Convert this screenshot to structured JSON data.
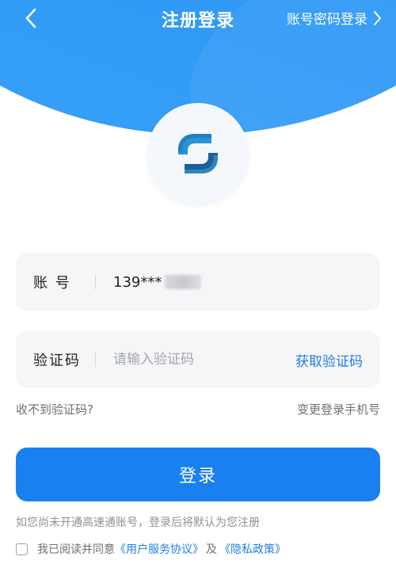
{
  "header": {
    "title": "注册登录",
    "password_login": "账号密码登录"
  },
  "form": {
    "account": {
      "label": "账 号",
      "value": "139***"
    },
    "code": {
      "label": "验证码",
      "placeholder": "请输入验证码",
      "get_code": "获取验证码"
    }
  },
  "links": {
    "no_code": "收不到验证码?",
    "change_phone": "变更登录手机号"
  },
  "login_button": "登录",
  "notice": "如您尚未开通高速通账号，登录后将默认为您注册",
  "agreement": {
    "prefix": "我已阅读并同意",
    "user_agreement": "《用户服务协议》",
    "and": "及",
    "privacy_policy": "《隐私政策》"
  },
  "colors": {
    "brand_blue": "#1a80ef",
    "link_blue": "#1f7fe6",
    "field_bg": "#f5f6f8"
  },
  "icons": {
    "back": "back-chevron-icon",
    "forward": "chevron-right-icon",
    "logo": "app-logo"
  }
}
